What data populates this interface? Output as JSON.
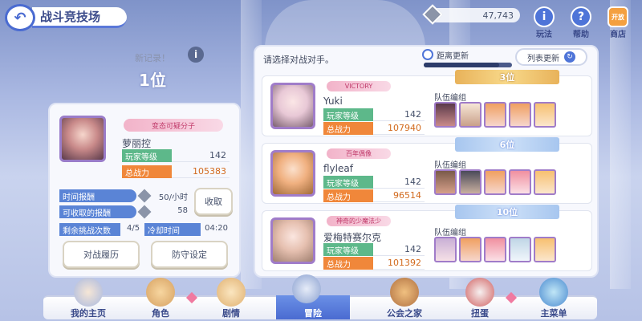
{
  "header": {
    "back_icon": "back-arrow-icon",
    "title": "战斗竞技场"
  },
  "currency": {
    "icon": "jewel-icon",
    "amount": "47,743"
  },
  "top_buttons": [
    {
      "label": "玩法",
      "icon": "info-icon"
    },
    {
      "label": "帮助",
      "icon": "help-icon"
    },
    {
      "label": "商店",
      "icon": "shop-icon",
      "icon_text": "开放"
    }
  ],
  "record": {
    "label": "新记录！",
    "rank": "1位",
    "info_icon": "i"
  },
  "player": {
    "title_badge": "变态可疑分子",
    "name": "萝丽控",
    "level_label": "玩家等级",
    "level": "142",
    "power_label": "总战力",
    "power": "105383"
  },
  "rewards": {
    "time_reward_label": "时间报酬",
    "time_reward_value": "50/小时",
    "collectable_label": "可收取的报酬",
    "collectable_value": "58",
    "collect_button": "收取",
    "remaining_label": "剩余挑战次数",
    "remaining_value": "4/5",
    "cooldown_label": "冷却时间",
    "cooldown_value": "04:20"
  },
  "buttons": {
    "history": "对战履历",
    "defense": "防守设定"
  },
  "opponents_panel": {
    "prompt": "请选择对战对手。",
    "timer_label": "距离更新",
    "refresh_button": "列表更新",
    "team_label": "队伍编组",
    "level_label": "玩家等级",
    "power_label": "总战力"
  },
  "opponents": [
    {
      "rank": "3位",
      "badge": "VICTORY",
      "name": "Yuki",
      "level": "142",
      "power": "107940"
    },
    {
      "rank": "6位",
      "badge": "百年偶像",
      "name": "flyleaf",
      "level": "142",
      "power": "96514"
    },
    {
      "rank": "10位",
      "badge": "神奇的少魔法少",
      "name": "爱梅特赛尔克",
      "level": "142",
      "power": "101392"
    }
  ],
  "bottom_nav": [
    {
      "label": "我的主页"
    },
    {
      "label": "角色"
    },
    {
      "label": "剧情"
    },
    {
      "label": "冒险"
    },
    {
      "label": "公会之家"
    },
    {
      "label": "扭蛋"
    },
    {
      "label": "主菜单"
    }
  ],
  "colors": {
    "accent": "#4e74d8",
    "level_tag": "#5db88a",
    "power_tag": "#f0873a",
    "power_value": "#d26a1e"
  }
}
